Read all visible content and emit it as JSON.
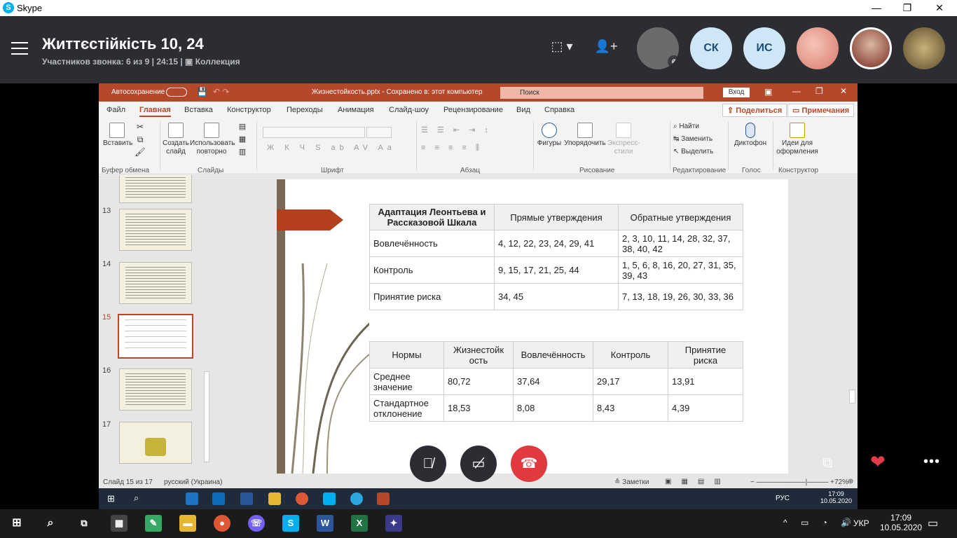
{
  "skype": {
    "app_title": "Skype",
    "minimize": "—",
    "restore": "❐",
    "close": "✕",
    "call_title": "Життєстійкість 10, 24",
    "call_subtitle": "Участников звонка: 6 из 9 | 24:15 | ",
    "collection": "Коллекция",
    "participants": [
      {
        "initials": "",
        "color": "#6b6b6b"
      },
      {
        "initials": "СК",
        "color": "#cfe6f6"
      },
      {
        "initials": "ИС",
        "color": "#cfe6f6"
      },
      {
        "initials": "",
        "color": "#e99a8e"
      },
      {
        "initials": "",
        "color": "#8a3b2e"
      },
      {
        "initials": "",
        "color": "#8c7e5a"
      }
    ]
  },
  "powerpoint": {
    "autosave": "Автосохранение",
    "file_name": "Жизнестойкость.pptx - Сохранено в: этот компьютер",
    "search_placeholder": "Поиск",
    "signin": "Вход",
    "tabs": [
      "Файл",
      "Главная",
      "Вставка",
      "Конструктор",
      "Переходы",
      "Анимация",
      "Слайд-шоу",
      "Рецензирование",
      "Вид",
      "Справка"
    ],
    "share": "Поделиться",
    "comments": "Примечания",
    "ribbon": {
      "paste": "Вставить",
      "create_slide": "Создать слайд",
      "reuse": "Использовать повторно",
      "shapes": "Фигуры",
      "arrange": "Упорядочить",
      "express_styles": "Экспресс-стили",
      "find": "Найти",
      "replace": "Заменить",
      "select": "Выделить",
      "dictate": "Диктофон",
      "design_ideas": "Идеи для оформления",
      "groups": [
        "Буфер обмена",
        "Слайды",
        "Шрифт",
        "Абзац",
        "Рисование",
        "Редактирование",
        "Голос",
        "Конструктор"
      ]
    },
    "slide_numbers": [
      "13",
      "14",
      "15",
      "16",
      "17"
    ],
    "status": {
      "slide": "Слайд 15 из 17",
      "lang": "русский (Украина)",
      "notes": "Заметки",
      "zoom": "72%"
    }
  },
  "slide": {
    "table1": {
      "header": [
        "Адаптация Леонтьева и Рассказовой  Шкала",
        "Прямые утверждения",
        "Обратные утверждения"
      ],
      "rows": [
        [
          "Вовлечённость",
          "4, 12, 22, 23, 24, 29, 41",
          "2, 3, 10, 11, 14, 28, 32, 37, 38, 40, 42"
        ],
        [
          "Контроль",
          "9, 15, 17, 21, 25, 44",
          "1, 5, 6, 8, 16, 20, 27, 31, 35, 39, 43"
        ],
        [
          "Принятие риска",
          "34, 45",
          "7, 13, 18, 19, 26, 30, 33, 36"
        ]
      ]
    },
    "table2": {
      "header": [
        "Нормы",
        "Жизнестойк ость",
        "Вовлечённость",
        "Контроль",
        "Принятие риска"
      ],
      "rows": [
        [
          "Среднее значение",
          "80,72",
          "37,64",
          "29,17",
          "13,91"
        ],
        [
          "Стандартное отклонение",
          "18,53",
          "8,08",
          "8,43",
          "4,39"
        ]
      ]
    }
  },
  "inner_taskbar": {
    "lang": "РУС",
    "time": "17:09",
    "date": "10.05.2020"
  },
  "taskbar": {
    "lang": "УКР",
    "time": "17:09",
    "date": "10.05.2020"
  }
}
